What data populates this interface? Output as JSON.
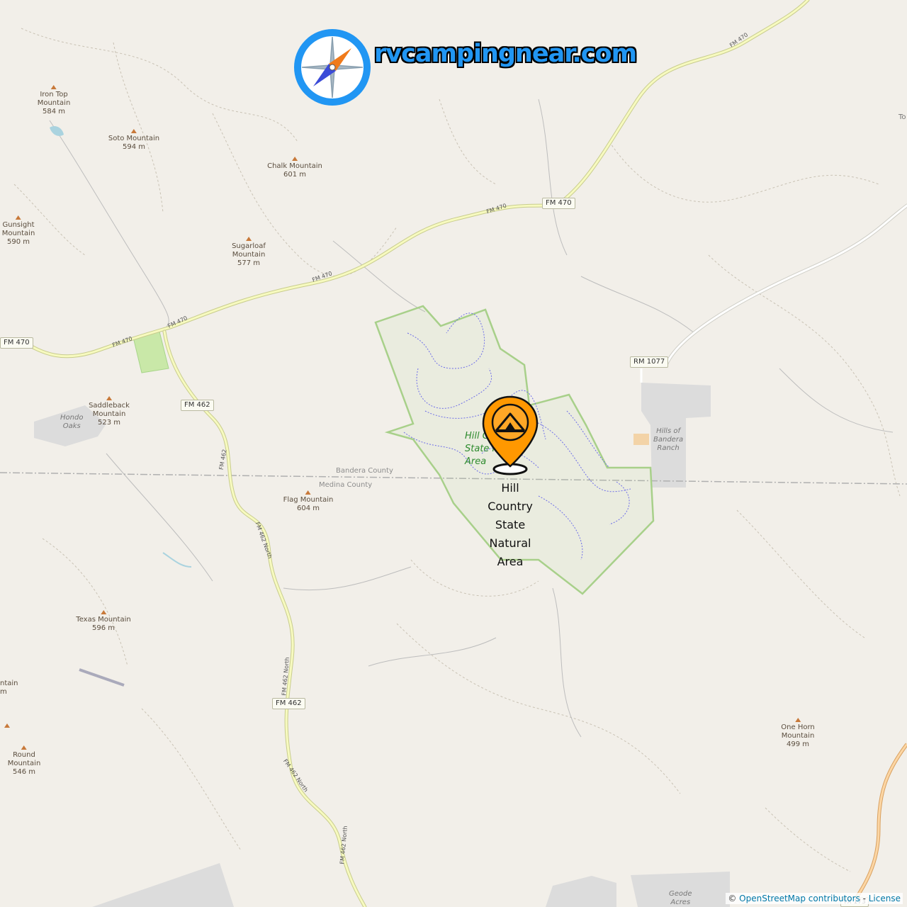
{
  "brand": {
    "logo_text": "rvcampingnear.com",
    "logo_icon": "compass-icon",
    "colors": {
      "ring": "#2196f3",
      "needle_north": "#f07a1a",
      "needle_south": "#3b4bd8"
    }
  },
  "peaks": [
    {
      "name": "Iron Top\nMountain",
      "elevation": "584 m"
    },
    {
      "name": "Soto Mountain",
      "elevation": "594 m"
    },
    {
      "name": "Chalk Mountain",
      "elevation": "601 m"
    },
    {
      "name": "Gunsight\nMountain",
      "elevation": "590 m"
    },
    {
      "name": "Sugarloaf\nMountain",
      "elevation": "577 m"
    },
    {
      "name": "Saddleback\nMountain",
      "elevation": "523 m"
    },
    {
      "name": "Flag Mountain",
      "elevation": "604 m"
    },
    {
      "name": "Texas Mountain",
      "elevation": "596 m"
    },
    {
      "name": "Round\nMountain",
      "elevation": "546 m"
    },
    {
      "name": "One Horn\nMountain",
      "elevation": "499 m"
    },
    {
      "name": "ntain",
      "elevation": "m"
    }
  ],
  "road_shields": [
    "FM 470",
    "FM 470",
    "FM 462",
    "FM 462",
    "RM 1077",
    "TX 173"
  ],
  "road_labels": [
    "FM 470",
    "FM 470",
    "FM 470",
    "FM 470",
    "FM 470",
    "FM 462",
    "FM 462 North",
    "FM 462 North",
    "FM 462 North",
    "FM 462 North"
  ],
  "counties": [
    "Bandera County",
    "Medina County"
  ],
  "places": [
    "Hondo\nOaks",
    "Hills of\nBandera\nRanch",
    "Geode\nAcres",
    "To"
  ],
  "park": {
    "map_label": "Hill Country\nState Natural\nArea"
  },
  "poi": {
    "label": "Hill\nCountry\nState\nNatural\nArea",
    "icon": "rv-campground-pin-icon",
    "color": "#ff9800"
  },
  "attribution": {
    "prefix": "©",
    "link": "OpenStreetMap contributors",
    "separator": " - ",
    "license": "License"
  }
}
